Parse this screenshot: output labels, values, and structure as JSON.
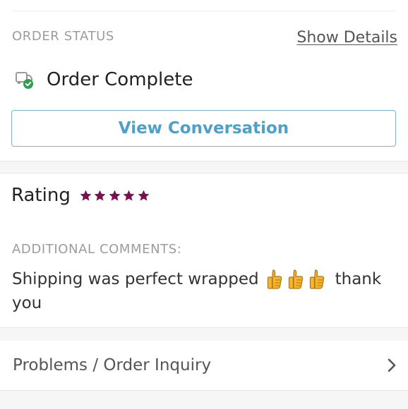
{
  "order_status": {
    "label": "ORDER STATUS",
    "show_details": "Show Details",
    "status_text": "Order Complete",
    "status_icon": "truck-check-icon",
    "view_conversation": "View Conversation"
  },
  "rating": {
    "label": "Rating",
    "stars": 5,
    "max_stars": 5,
    "star_color": "#7a1050"
  },
  "comments": {
    "label": "ADDITIONAL COMMENTS:",
    "text_before": "Shipping was perfect wrapped",
    "emoji_count": 3,
    "emoji_icon": "thumbs-up-icon",
    "text_after": "thank",
    "text_line2": "you"
  },
  "inquiry": {
    "label": "Problems / Order Inquiry"
  },
  "colors": {
    "accent_blue": "#4ea0c9",
    "success_green": "#2e9e4f",
    "label_gray": "#9c9c9c"
  }
}
